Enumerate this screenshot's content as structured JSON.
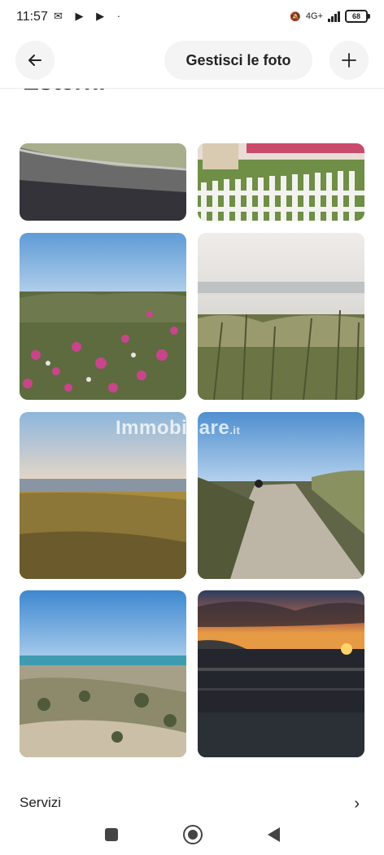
{
  "status_bar": {
    "time": "11:57",
    "left_icons": "✉ ▶ ▶ ·",
    "network_label": "4G+",
    "battery": "68"
  },
  "header": {
    "back_icon": "arrow-left-icon",
    "manage_label": "Gestisci le foto",
    "add_icon": "plus-icon"
  },
  "section": {
    "title": "Esterni"
  },
  "gallery": {
    "photos": [
      {
        "name": "photo-dune-wall",
        "scene": "dune path with stone wall"
      },
      {
        "name": "photo-garden-fence",
        "scene": "garden with white picket fence"
      },
      {
        "name": "photo-pink-flowers",
        "scene": "coastal dunes with pink flowers"
      },
      {
        "name": "photo-grass-haze",
        "scene": "dune grass in haze"
      },
      {
        "name": "photo-sea-grass",
        "scene": "sea with grassy dune"
      },
      {
        "name": "photo-sand-path",
        "scene": "sandy path to the beach"
      },
      {
        "name": "photo-beach-sky",
        "scene": "beach with blue sky"
      },
      {
        "name": "photo-sunset",
        "scene": "sea sunset"
      }
    ],
    "watermark": "Immobiliare",
    "watermark_suffix": ".it"
  },
  "services": {
    "label": "Servizi",
    "chevron_icon": "chevron-right-icon"
  },
  "nav": {
    "recent_icon": "square-icon",
    "home_icon": "circle-icon",
    "back_icon": "triangle-back-icon"
  }
}
